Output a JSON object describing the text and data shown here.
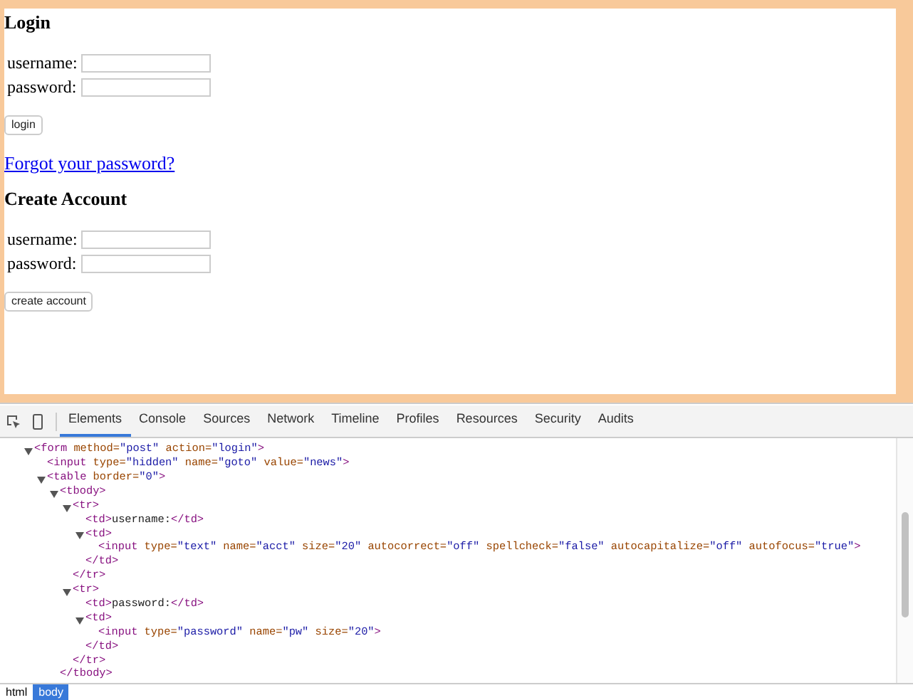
{
  "page": {
    "login": {
      "heading": "Login",
      "fields": [
        {
          "label": "username:"
        },
        {
          "label": "password:"
        }
      ],
      "button": "login"
    },
    "forgot_link": "Forgot your password?",
    "create": {
      "heading": "Create Account",
      "fields": [
        {
          "label": "username:"
        },
        {
          "label": "password:"
        }
      ],
      "button": "create account"
    }
  },
  "devtools": {
    "tabs": [
      {
        "label": "Elements",
        "selected": true
      },
      {
        "label": "Console",
        "selected": false
      },
      {
        "label": "Sources",
        "selected": false
      },
      {
        "label": "Network",
        "selected": false
      },
      {
        "label": "Timeline",
        "selected": false
      },
      {
        "label": "Profiles",
        "selected": false
      },
      {
        "label": "Resources",
        "selected": false
      },
      {
        "label": "Security",
        "selected": false
      },
      {
        "label": "Audits",
        "selected": false
      }
    ],
    "tree": [
      {
        "expanded": true,
        "open": [
          {
            "kind": "tag",
            "text": "<form"
          },
          {
            "kind": "attr",
            "text": " method="
          },
          {
            "kind": "value",
            "text": "\"post\""
          },
          {
            "kind": "attr",
            "text": " action="
          },
          {
            "kind": "value",
            "text": "\"login\""
          },
          {
            "kind": "tag",
            "text": ">"
          }
        ],
        "children": [
          {
            "open": [
              {
                "kind": "tag",
                "text": "<input"
              },
              {
                "kind": "attr",
                "text": " type="
              },
              {
                "kind": "value",
                "text": "\"hidden\""
              },
              {
                "kind": "attr",
                "text": " name="
              },
              {
                "kind": "value",
                "text": "\"goto\""
              },
              {
                "kind": "attr",
                "text": " value="
              },
              {
                "kind": "value",
                "text": "\"news\""
              },
              {
                "kind": "tag",
                "text": ">"
              }
            ]
          },
          {
            "expanded": true,
            "open": [
              {
                "kind": "tag",
                "text": "<table"
              },
              {
                "kind": "attr",
                "text": " border="
              },
              {
                "kind": "value",
                "text": "\"0\""
              },
              {
                "kind": "tag",
                "text": ">"
              }
            ],
            "children": [
              {
                "expanded": true,
                "open": [
                  {
                    "kind": "tag",
                    "text": "<tbody>"
                  }
                ],
                "children": [
                  {
                    "expanded": true,
                    "open": [
                      {
                        "kind": "tag",
                        "text": "<tr>"
                      }
                    ],
                    "children": [
                      {
                        "open": [
                          {
                            "kind": "tag",
                            "text": "<td>"
                          },
                          {
                            "kind": "text",
                            "text": "username:"
                          },
                          {
                            "kind": "tag",
                            "text": "</td>"
                          }
                        ]
                      },
                      {
                        "expanded": true,
                        "open": [
                          {
                            "kind": "tag",
                            "text": "<td>"
                          }
                        ],
                        "children": [
                          {
                            "open": [
                              {
                                "kind": "tag",
                                "text": "<input"
                              },
                              {
                                "kind": "attr",
                                "text": " type="
                              },
                              {
                                "kind": "value",
                                "text": "\"text\""
                              },
                              {
                                "kind": "attr",
                                "text": " name="
                              },
                              {
                                "kind": "value",
                                "text": "\"acct\""
                              },
                              {
                                "kind": "attr",
                                "text": " size="
                              },
                              {
                                "kind": "value",
                                "text": "\"20\""
                              },
                              {
                                "kind": "attr",
                                "text": " autocorrect="
                              },
                              {
                                "kind": "value",
                                "text": "\"off\""
                              },
                              {
                                "kind": "attr",
                                "text": " spellcheck="
                              },
                              {
                                "kind": "value",
                                "text": "\"false\""
                              },
                              {
                                "kind": "attr",
                                "text": " autocapitalize="
                              },
                              {
                                "kind": "value",
                                "text": "\"off\""
                              },
                              {
                                "kind": "attr",
                                "text": " autofocus="
                              },
                              {
                                "kind": "value",
                                "text": "\"true\""
                              },
                              {
                                "kind": "tag",
                                "text": ">"
                              }
                            ]
                          }
                        ],
                        "close": [
                          {
                            "kind": "tag",
                            "text": "</td>"
                          }
                        ]
                      }
                    ],
                    "close": [
                      {
                        "kind": "tag",
                        "text": "</tr>"
                      }
                    ]
                  },
                  {
                    "expanded": true,
                    "open": [
                      {
                        "kind": "tag",
                        "text": "<tr>"
                      }
                    ],
                    "children": [
                      {
                        "open": [
                          {
                            "kind": "tag",
                            "text": "<td>"
                          },
                          {
                            "kind": "text",
                            "text": "password:"
                          },
                          {
                            "kind": "tag",
                            "text": "</td>"
                          }
                        ]
                      },
                      {
                        "expanded": true,
                        "open": [
                          {
                            "kind": "tag",
                            "text": "<td>"
                          }
                        ],
                        "children": [
                          {
                            "open": [
                              {
                                "kind": "tag",
                                "text": "<input"
                              },
                              {
                                "kind": "attr",
                                "text": " type="
                              },
                              {
                                "kind": "value",
                                "text": "\"password\""
                              },
                              {
                                "kind": "attr",
                                "text": " name="
                              },
                              {
                                "kind": "value",
                                "text": "\"pw\""
                              },
                              {
                                "kind": "attr",
                                "text": " size="
                              },
                              {
                                "kind": "value",
                                "text": "\"20\""
                              },
                              {
                                "kind": "tag",
                                "text": ">"
                              }
                            ]
                          }
                        ],
                        "close": [
                          {
                            "kind": "tag",
                            "text": "</td>"
                          }
                        ]
                      }
                    ],
                    "close": [
                      {
                        "kind": "tag",
                        "text": "</tr>"
                      }
                    ]
                  }
                ],
                "close": [
                  {
                    "kind": "tag",
                    "text": "</tbody>"
                  }
                ]
              }
            ]
          }
        ]
      }
    ],
    "breadcrumbs": [
      {
        "label": "html",
        "selected": false
      },
      {
        "label": "body",
        "selected": true
      }
    ]
  }
}
